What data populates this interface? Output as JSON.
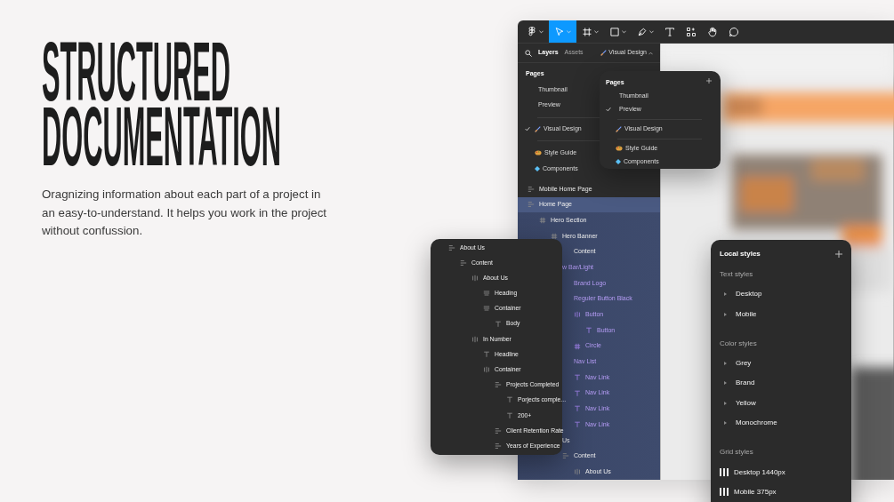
{
  "hero": {
    "heading_lines": [
      "STRUCTURED",
      "DOCUMENTATION"
    ],
    "description": "Oragnizing information about each part of a project in an easy-to-understand. It helps you work in the project without confussion."
  },
  "editor": {
    "toolbar": [
      {
        "kind": "logo",
        "selected": false,
        "caret": true
      },
      {
        "kind": "move",
        "selected": true,
        "caret": true
      },
      {
        "kind": "frame",
        "selected": false,
        "caret": true
      },
      {
        "kind": "shape",
        "selected": false,
        "caret": true
      },
      {
        "kind": "pen",
        "selected": false,
        "caret": true
      },
      {
        "kind": "text",
        "selected": false,
        "caret": false
      },
      {
        "kind": "resources",
        "selected": false,
        "caret": false
      },
      {
        "kind": "hand",
        "selected": false,
        "caret": false
      },
      {
        "kind": "comment",
        "selected": false,
        "caret": false
      }
    ],
    "panel_tabs": [
      {
        "label": "Layers",
        "selected": true
      },
      {
        "label": "Assets",
        "selected": false
      }
    ],
    "page_switcher": "Visual Design",
    "pages_title": "Pages",
    "page_groups": [
      [
        {
          "label": "Thumbnail",
          "checked": false
        },
        {
          "label": "Preview",
          "checked": false
        }
      ],
      [
        {
          "label": "Visual Design",
          "kind": "pencil",
          "checked": true
        }
      ],
      [
        {
          "label": "Style Guide",
          "kind": "palette",
          "checked": false
        },
        {
          "label": "Components",
          "kind": "diamond",
          "checked": false
        }
      ]
    ],
    "layers": [
      {
        "label": "Mobile Home Page",
        "kind": "stack",
        "component": false,
        "selected": false
      },
      {
        "label": "Home Page",
        "kind": "stack",
        "component": false,
        "selected": true,
        "children": [
          {
            "label": "Hero Section",
            "kind": "hash",
            "component": false,
            "selected": false,
            "children": [
              {
                "label": "Hero Banner",
                "kind": "hash",
                "component": false,
                "selected": false,
                "children": [
                  {
                    "label": "Content",
                    "component": false,
                    "selected": false
                  }
                ]
              },
              {
                "label": "w Bar/Light",
                "component": true,
                "selected": false,
                "children": [
                  {
                    "label": "Brand Logo",
                    "component": true,
                    "selected": false
                  },
                  {
                    "label": "Reguler Button Black",
                    "component": true,
                    "selected": false,
                    "children": [
                      {
                        "label": "Button",
                        "kind": "columns",
                        "component": true,
                        "selected": false,
                        "children": [
                          {
                            "label": "Button",
                            "kind": "text",
                            "component": true,
                            "selected": false
                          }
                        ]
                      },
                      {
                        "label": "Circle",
                        "kind": "hash",
                        "component": true,
                        "selected": false
                      }
                    ]
                  },
                  {
                    "label": "Nav List",
                    "component": true,
                    "selected": false,
                    "children": [
                      {
                        "label": "Nav Link",
                        "kind": "text",
                        "component": true,
                        "selected": false
                      },
                      {
                        "label": "Nav Link",
                        "kind": "text",
                        "component": true,
                        "selected": false
                      },
                      {
                        "label": "Nav Link",
                        "kind": "text",
                        "component": true,
                        "selected": false
                      },
                      {
                        "label": "Nav Link",
                        "kind": "text",
                        "component": true,
                        "selected": false
                      }
                    ]
                  }
                ]
              },
              {
                "label": "Us",
                "component": false,
                "selected": false,
                "children": [
                  {
                    "label": "Content",
                    "kind": "stack",
                    "component": false,
                    "selected": false,
                    "children": [
                      {
                        "label": "About Us",
                        "kind": "columns",
                        "component": false,
                        "selected": false
                      }
                    ]
                  }
                ]
              }
            ]
          }
        ]
      }
    ],
    "canvas": {
      "kind": "picture"
    }
  },
  "pages_popup": {
    "title": "Pages",
    "page_groups": [
      [
        {
          "label": "Thumbnail",
          "checked": false
        },
        {
          "label": "Preview",
          "checked": true
        }
      ],
      [
        {
          "label": "Visual Design",
          "kind": "pencil",
          "checked": false
        }
      ],
      [
        {
          "label": "Style Guide",
          "kind": "palette",
          "checked": false
        },
        {
          "label": "Components",
          "kind": "diamond",
          "checked": false
        }
      ]
    ]
  },
  "layers_popup": {
    "layers": [
      {
        "label": "About Us",
        "kind": "stack",
        "children": [
          {
            "label": "Content",
            "kind": "stack",
            "children": [
              {
                "label": "About Us",
                "kind": "columns",
                "children": [
                  {
                    "label": "Heading",
                    "kind": "rows"
                  },
                  {
                    "label": "Container",
                    "kind": "rows",
                    "children": [
                      {
                        "label": "Body",
                        "kind": "text"
                      }
                    ]
                  }
                ]
              },
              {
                "label": "In Number",
                "kind": "columns",
                "children": [
                  {
                    "label": "Headline",
                    "kind": "text"
                  },
                  {
                    "label": "Container",
                    "kind": "columns",
                    "children": [
                      {
                        "label": "Projects Completed",
                        "kind": "stack",
                        "children": [
                          {
                            "label": "Porjects comple...",
                            "kind": "text"
                          },
                          {
                            "label": "200+",
                            "kind": "text"
                          }
                        ]
                      },
                      {
                        "label": "Client Retention Rate",
                        "kind": "stack"
                      },
                      {
                        "label": "Years of Experience",
                        "kind": "stack"
                      }
                    ]
                  }
                ]
              }
            ]
          }
        ]
      }
    ]
  },
  "local_styles": {
    "title": "Local styles",
    "sections": [
      {
        "title": "Text styles",
        "kind": "folder",
        "items": [
          "Desktop",
          "Mobile"
        ]
      },
      {
        "title": "Color styles",
        "kind": "folder",
        "items": [
          "Grey",
          "Brand",
          "Yellow",
          "Monochrome"
        ]
      },
      {
        "title": "Grid styles",
        "kind": "grid",
        "items": [
          "Desktop 1440px",
          "Mobile 375px"
        ]
      }
    ]
  }
}
